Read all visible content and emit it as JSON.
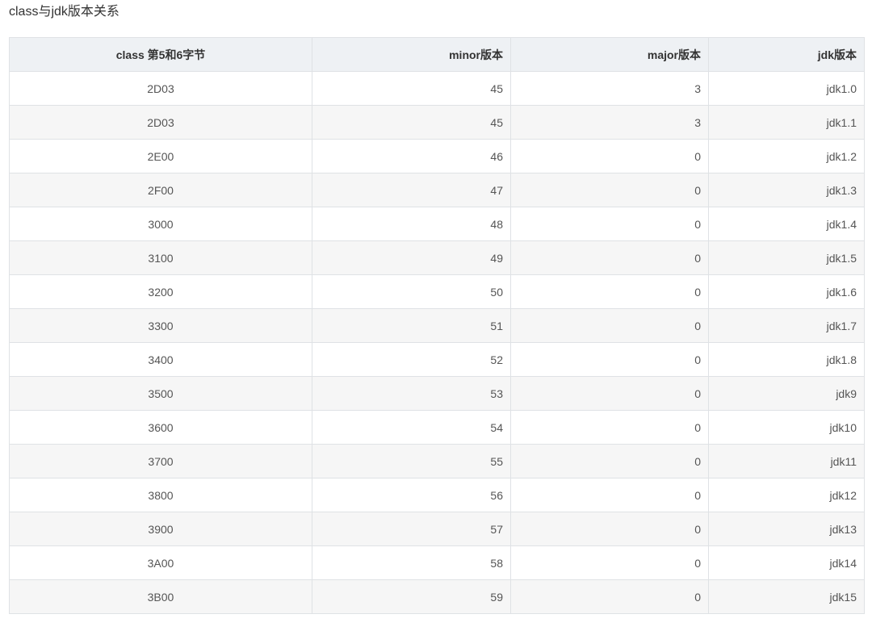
{
  "title": "class与jdk版本关系",
  "table": {
    "headers": [
      "class 第5和6字节",
      "minor版本",
      "major版本",
      "jdk版本"
    ],
    "rows": [
      [
        "2D03",
        "45",
        "3",
        "jdk1.0"
      ],
      [
        "2D03",
        "45",
        "3",
        "jdk1.1"
      ],
      [
        "2E00",
        "46",
        "0",
        "jdk1.2"
      ],
      [
        "2F00",
        "47",
        "0",
        "jdk1.3"
      ],
      [
        "3000",
        "48",
        "0",
        "jdk1.4"
      ],
      [
        "3100",
        "49",
        "0",
        "jdk1.5"
      ],
      [
        "3200",
        "50",
        "0",
        "jdk1.6"
      ],
      [
        "3300",
        "51",
        "0",
        "jdk1.7"
      ],
      [
        "3400",
        "52",
        "0",
        "jdk1.8"
      ],
      [
        "3500",
        "53",
        "0",
        "jdk9"
      ],
      [
        "3600",
        "54",
        "0",
        "jdk10"
      ],
      [
        "3700",
        "55",
        "0",
        "jdk11"
      ],
      [
        "3800",
        "56",
        "0",
        "jdk12"
      ],
      [
        "3900",
        "57",
        "0",
        "jdk13"
      ],
      [
        "3A00",
        "58",
        "0",
        "jdk14"
      ],
      [
        "3B00",
        "59",
        "0",
        "jdk15"
      ]
    ]
  }
}
